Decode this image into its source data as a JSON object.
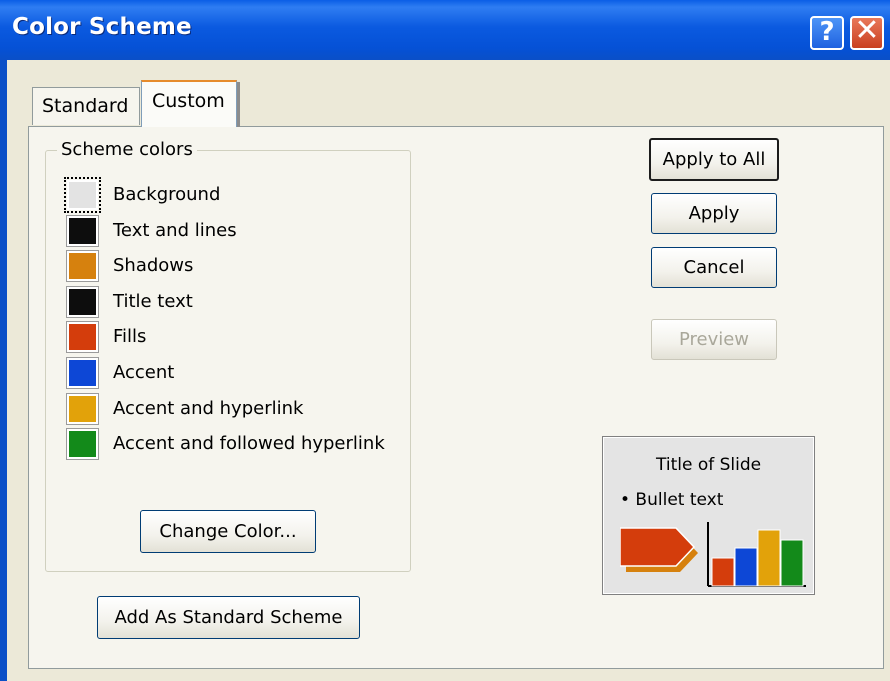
{
  "window": {
    "title": "Color Scheme",
    "help_label": "?",
    "close_label": "✕"
  },
  "tabs": [
    {
      "label": "Standard"
    },
    {
      "label": "Custom",
      "active": true
    }
  ],
  "scheme_colors": {
    "group_label": "Scheme colors",
    "items": [
      {
        "label": "Background",
        "color": "#e3e3e3",
        "selected": true
      },
      {
        "label": "Text and lines",
        "color": "#0d0d0d"
      },
      {
        "label": "Shadows",
        "color": "#d6810e"
      },
      {
        "label": "Title text",
        "color": "#0d0d0d"
      },
      {
        "label": "Fills",
        "color": "#d43d0c"
      },
      {
        "label": "Accent",
        "color": "#0d47d6"
      },
      {
        "label": "Accent and hyperlink",
        "color": "#e2a20a"
      },
      {
        "label": "Accent and followed hyperlink",
        "color": "#138a1a"
      }
    ],
    "change_color_label": "Change Color..."
  },
  "add_standard_label": "Add As Standard Scheme",
  "buttons": {
    "apply_all": "Apply to All",
    "apply": "Apply",
    "cancel": "Cancel",
    "preview": "Preview"
  },
  "preview": {
    "title": "Title of Slide",
    "bullet": "• Bullet text",
    "bar_colors": [
      "#d43d0c",
      "#0d47d6",
      "#e2a20a",
      "#138a1a"
    ]
  }
}
